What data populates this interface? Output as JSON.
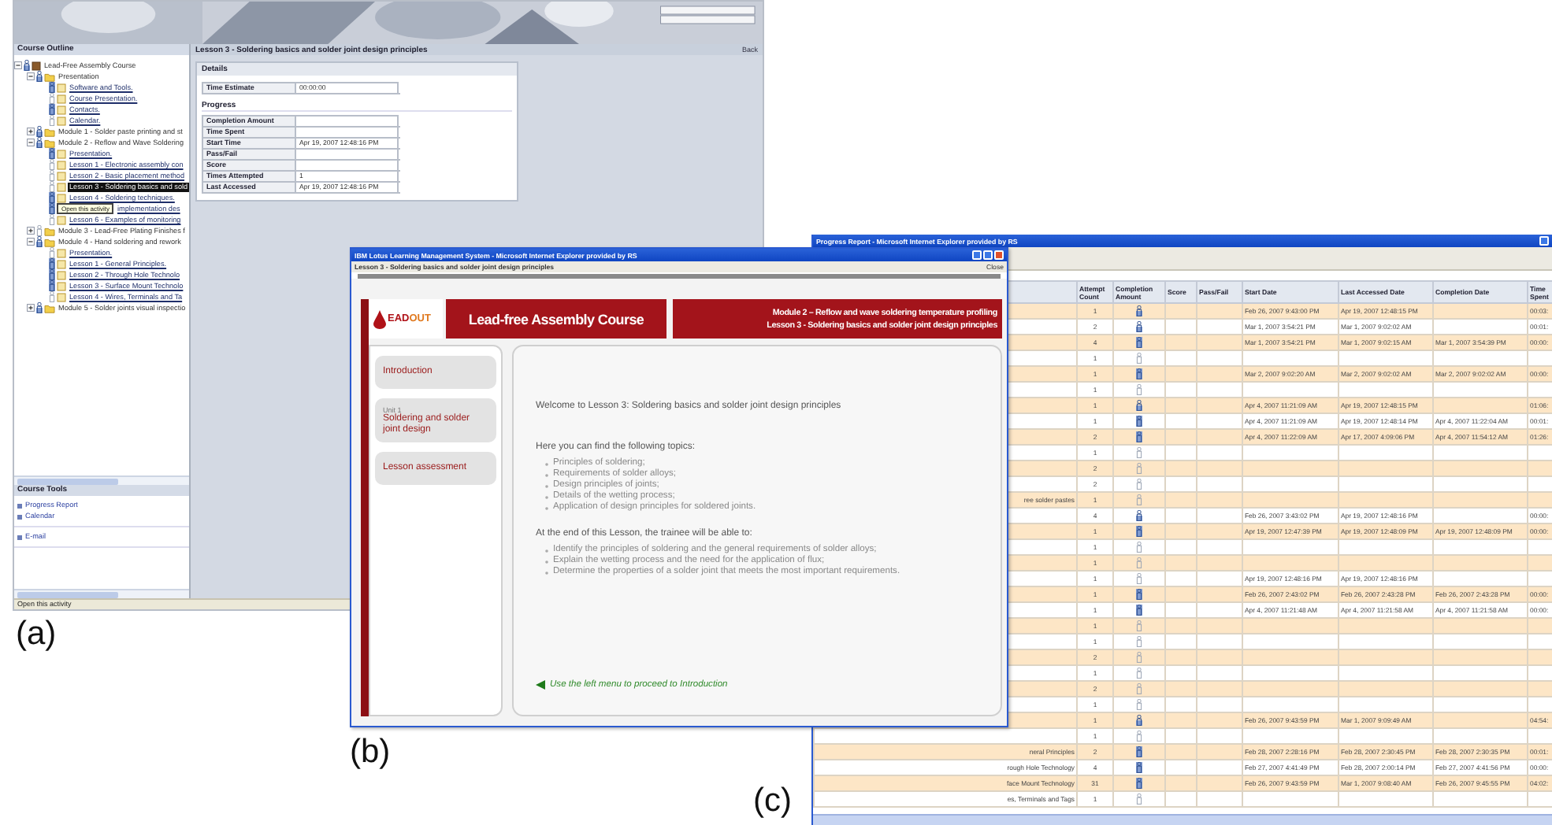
{
  "panel_labels": [
    "(a)",
    "(b)",
    "(c)"
  ],
  "course_window": {
    "outline_title": "Course Outline",
    "tree": [
      {
        "label": "Lead-Free Assembly Course",
        "kind": "course",
        "level": 0.5,
        "expanded": true,
        "selected": false,
        "children": [
          {
            "label": "Presentation",
            "kind": "folder",
            "level": 0.5,
            "expanded": true,
            "selected": false,
            "children": [
              {
                "label": "Software and Tools.",
                "kind": "page",
                "level": 1,
                "selected": false
              },
              {
                "label": "Course Presentation.",
                "kind": "page",
                "level": 0,
                "selected": false
              },
              {
                "label": "Contacts.",
                "kind": "page",
                "level": 1,
                "selected": false
              },
              {
                "label": "Calendar.",
                "kind": "page",
                "level": 0,
                "selected": false
              }
            ]
          },
          {
            "label": "Module 1 - Solder paste printing and st",
            "kind": "folder",
            "level": 0.5,
            "expanded": false,
            "selected": false
          },
          {
            "label": "Module 2 - Reflow and Wave Soldering",
            "kind": "folder",
            "level": 0.5,
            "expanded": true,
            "selected": false,
            "children": [
              {
                "label": "Presentation.",
                "kind": "page",
                "level": 1,
                "selected": false
              },
              {
                "label": "Lesson 1 - Electronic assembly con",
                "kind": "page",
                "level": 0,
                "selected": false
              },
              {
                "label": "Lesson 2 - Basic placement method",
                "kind": "page",
                "level": 0,
                "selected": false
              },
              {
                "label": "Lesson 3 - Soldering basics and sold",
                "kind": "page",
                "level": 0,
                "selected": true
              },
              {
                "label": "Lesson 4 - Soldering techniques.",
                "kind": "page",
                "level": 1,
                "selected": false
              },
              {
                "label": "implementation des",
                "kind": "page",
                "level": 1,
                "selected": false,
                "tooltip": "Open this activity"
              },
              {
                "label": "Lesson 6 - Examples of monitoring",
                "kind": "page",
                "level": 0,
                "selected": false
              }
            ]
          },
          {
            "label": "Module 3 - Lead-Free Plating Finishes f",
            "kind": "folder",
            "level": 0,
            "expanded": false,
            "selected": false
          },
          {
            "label": "Module 4 - Hand soldering and rework",
            "kind": "folder",
            "level": 0.5,
            "expanded": true,
            "selected": false,
            "children": [
              {
                "label": "Presentation.",
                "kind": "page",
                "level": 0,
                "selected": false
              },
              {
                "label": "Lesson 1 - General Principles.",
                "kind": "page",
                "level": 1,
                "selected": false
              },
              {
                "label": "Lesson 2 - Through Hole Technolo",
                "kind": "page",
                "level": 1,
                "selected": false
              },
              {
                "label": "Lesson 3 - Surface Mount Technolo",
                "kind": "page",
                "level": 1,
                "selected": false
              },
              {
                "label": "Lesson 4 - Wires, Terminals and Ta",
                "kind": "page",
                "level": 0,
                "selected": false
              }
            ]
          },
          {
            "label": "Module 5 - Solder joints visual inspectio",
            "kind": "folder",
            "level": 0.5,
            "expanded": false,
            "selected": false
          }
        ]
      }
    ],
    "tools_title": "Course Tools",
    "tools": [
      [
        "Progress Report",
        "Calendar"
      ],
      [
        "E-mail"
      ]
    ],
    "lesson_title": "Lesson 3 - Soldering basics and solder joint design principles",
    "header_link": "Back",
    "details_title": "Details",
    "time_estimate": {
      "label": "Time Estimate",
      "value": "00:00:00"
    },
    "progress_title": "Progress",
    "progress": [
      {
        "label": "Completion Amount"
      },
      {
        "label": "Time Spent"
      },
      {
        "label": "Start Time",
        "value": "Apr 19, 2007 12:48:16 PM"
      },
      {
        "label": "Pass/Fail"
      },
      {
        "label": "Score"
      },
      {
        "label": "Times Attempted",
        "value": "1"
      },
      {
        "label": "Last Accessed",
        "value": "Apr 19, 2007 12:48:16 PM"
      }
    ],
    "status_bar": "Open this activity"
  },
  "lesson_window": {
    "title": "IBM Lotus Learning Management System - Microsoft Internet Explorer provided by RS",
    "subtitle": "Lesson 3 - Soldering basics and solder joint design principles",
    "close": "Close",
    "logo_main": "EAD",
    "logo_accent": "OUT",
    "course_title": "Lead-free Assembly Course",
    "module_line": "Module 2 – Reflow and wave soldering temperature profiling",
    "lesson_line": "Lesson 3 - Soldering basics and solder joint design principles",
    "menu": [
      {
        "label": "Introduction"
      },
      {
        "caption": "Unit 1",
        "label": "Soldering and solder joint design"
      },
      {
        "label": "Lesson assessment"
      }
    ],
    "welcome": "Welcome to Lesson 3: Soldering basics and solder joint design principles",
    "topics_intro": "Here you can find the following topics:",
    "topics": [
      "Principles of soldering;",
      "Requirements of solder alloys;",
      "Design principles of joints;",
      "Details of the wetting process;",
      "Application of design principles for soldered joints."
    ],
    "outcomes_intro": "At the end of this Lesson, the trainee will be able to:",
    "outcomes": [
      "Identify the principles of soldering and the general requirements of solder alloys;",
      "Explain the wetting process and the need for the application of flux;",
      "Determine the properties of a solder joint that meets the most important requirements."
    ],
    "hint": "Use the left menu to proceed to Introduction"
  },
  "report_window": {
    "title": "Progress Report - Microsoft Internet Explorer provided by RS",
    "columns": [
      "Attempt Count",
      "Completion Amount",
      "Score",
      "Pass/Fail",
      "Start Date",
      "Last Accessed Date",
      "Completion Date",
      "Time Spent"
    ],
    "rows": [
      {
        "attempts": "1",
        "level": 0.5,
        "start": "Feb 26, 2007 9:43:00 PM",
        "last": "Apr 19, 2007 12:48:15 PM",
        "time": "00:03:"
      },
      {
        "attempts": "2",
        "level": 0.5,
        "start": "Mar 1, 2007 3:54:21 PM",
        "last": "Mar 1, 2007 9:02:02 AM",
        "time": "00:01:"
      },
      {
        "attempts": "4",
        "level": 1,
        "start": "Mar 1, 2007 3:54:21 PM",
        "last": "Mar 1, 2007 9:02:15 AM",
        "completed": "Mar 1, 2007 3:54:39 PM",
        "time": "00:00:"
      },
      {
        "attempts": "1",
        "level": 0
      },
      {
        "attempts": "1",
        "level": 1,
        "start": "Mar 2, 2007 9:02:20 AM",
        "last": "Mar 2, 2007 9:02:02 AM",
        "completed": "Mar 2, 2007 9:02:02 AM",
        "time": "00:00:"
      },
      {
        "attempts": "1",
        "level": 0
      },
      {
        "attempts": "1",
        "level": 0.5,
        "start": "Apr 4, 2007 11:21:09 AM",
        "last": "Apr 19, 2007 12:48:15 PM",
        "time": "01:06:"
      },
      {
        "attempts": "1",
        "level": 1,
        "start": "Apr 4, 2007 11:21:09 AM",
        "last": "Apr 19, 2007 12:48:14 PM",
        "completed": "Apr 4, 2007 11:22:04 AM",
        "time": "00:01:"
      },
      {
        "attempts": "2",
        "level": 1,
        "start": "Apr 4, 2007 11:22:09 AM",
        "last": "Apr 17, 2007 4:09:06 PM",
        "completed": "Apr 4, 2007 11:54:12 AM",
        "time": "01:26:"
      },
      {
        "attempts": "1",
        "level": 0
      },
      {
        "attempts": "2",
        "level": 0
      },
      {
        "attempts": "2",
        "level": 0
      },
      {
        "name": "ree solder pastes",
        "attempts": "1",
        "level": 0
      },
      {
        "attempts": "4",
        "level": 0.5,
        "start": "Feb 26, 2007 3:43:02 PM",
        "last": "Apr 19, 2007 12:48:16 PM",
        "time": "00:00:"
      },
      {
        "attempts": "1",
        "level": 1,
        "start": "Apr 19, 2007 12:47:39 PM",
        "last": "Apr 19, 2007 12:48:09 PM",
        "completed": "Apr 19, 2007 12:48:09 PM",
        "time": "00:00:"
      },
      {
        "attempts": "1",
        "level": 0
      },
      {
        "attempts": "1",
        "level": 0
      },
      {
        "attempts": "1",
        "level": 0,
        "start": "Apr 19, 2007 12:48:16 PM",
        "last": "Apr 19, 2007 12:48:16 PM"
      },
      {
        "attempts": "1",
        "level": 1,
        "start": "Feb 26, 2007 2:43:02 PM",
        "last": "Feb 26, 2007 2:43:28 PM",
        "completed": "Feb 26, 2007 2:43:28 PM",
        "time": "00:00:"
      },
      {
        "attempts": "1",
        "level": 1,
        "start": "Apr 4, 2007 11:21:48 AM",
        "last": "Apr 4, 2007 11:21:58 AM",
        "completed": "Apr 4, 2007 11:21:58 AM",
        "time": "00:00:"
      },
      {
        "attempts": "1",
        "level": 0
      },
      {
        "attempts": "1",
        "level": 0
      },
      {
        "attempts": "2",
        "level": 0
      },
      {
        "attempts": "1",
        "level": 0
      },
      {
        "attempts": "2",
        "level": 0
      },
      {
        "attempts": "1",
        "level": 0
      },
      {
        "attempts": "1",
        "level": 0.5,
        "start": "Feb 26, 2007 9:43:59 PM",
        "last": "Mar 1, 2007 9:09:49 AM",
        "time": "04:54:"
      },
      {
        "attempts": "1",
        "level": 0
      },
      {
        "name": "neral Principles",
        "attempts": "2",
        "level": 1,
        "start": "Feb 28, 2007 2:28:16 PM",
        "last": "Feb 28, 2007 2:30:45 PM",
        "completed": "Feb 28, 2007 2:30:35 PM",
        "time": "00:01:"
      },
      {
        "name": "rough Hole Technology",
        "attempts": "4",
        "level": 1,
        "start": "Feb 27, 2007 4:41:49 PM",
        "last": "Feb 28, 2007 2:00:14 PM",
        "completed": "Feb 27, 2007 4:41:56 PM",
        "time": "00:00:"
      },
      {
        "name": "face Mount Technology",
        "attempts": "31",
        "level": 1,
        "start": "Feb 26, 2007 9:43:59 PM",
        "last": "Mar 1, 2007 9:08:40 AM",
        "completed": "Feb 26, 2007 9:45:55 PM",
        "time": "04:02:"
      },
      {
        "name": "es, Terminals and Tags",
        "attempts": "1",
        "level": 0
      }
    ]
  }
}
